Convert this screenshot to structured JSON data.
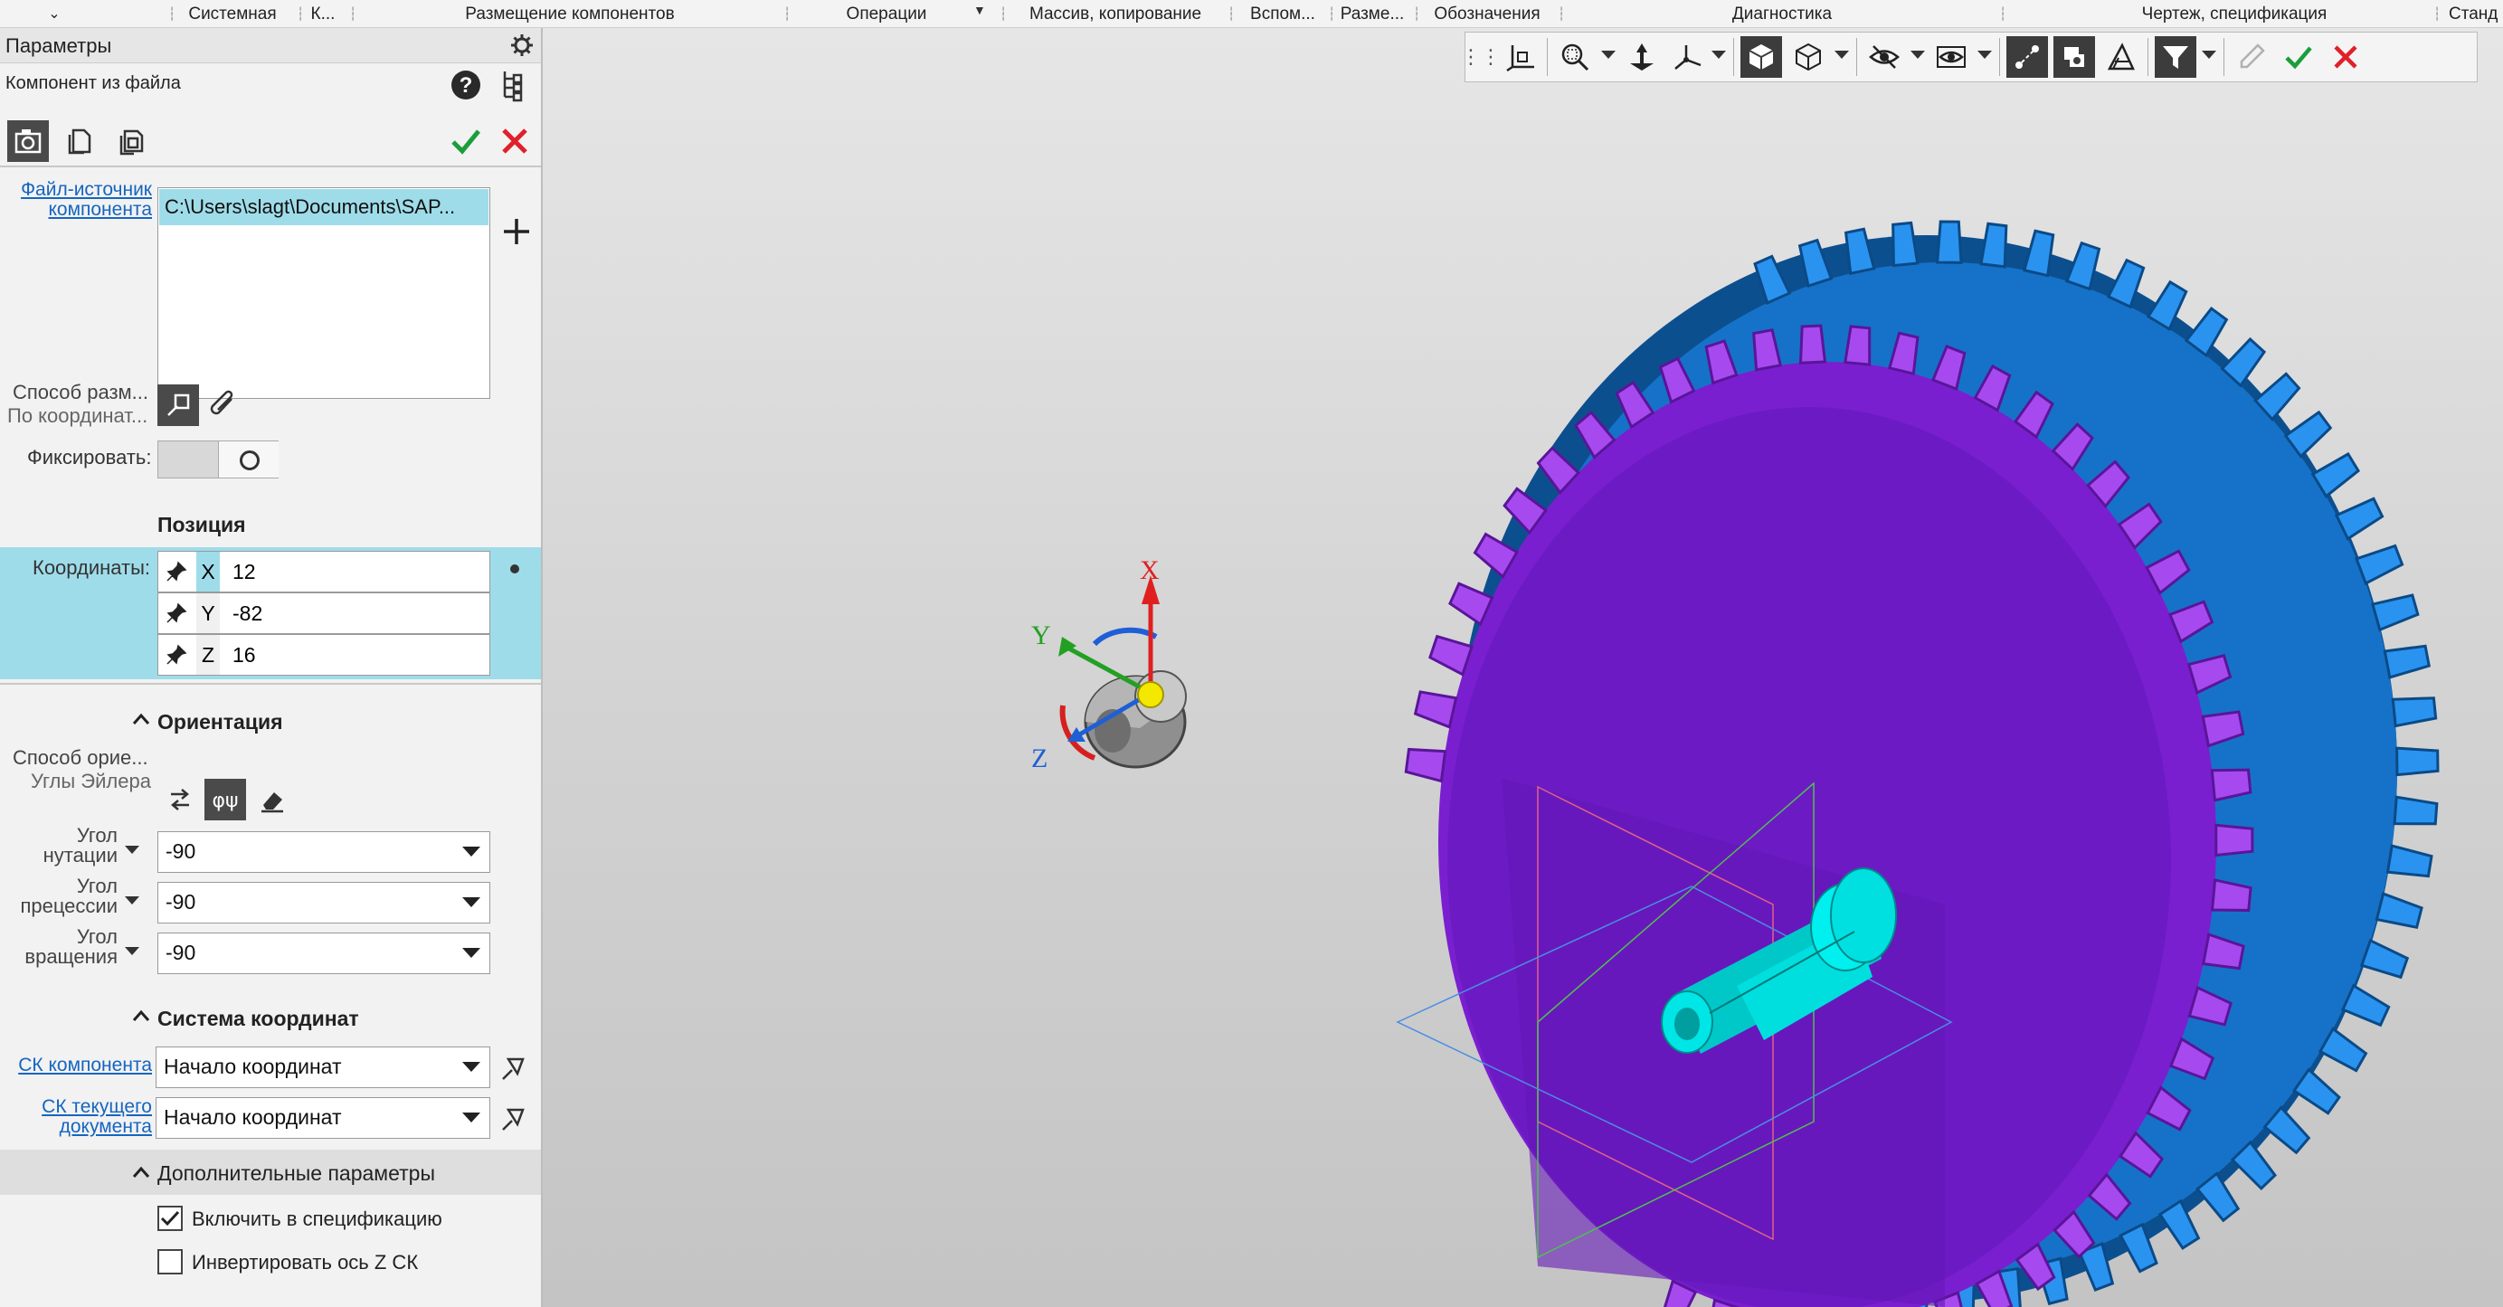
{
  "ribbon": {
    "tabs": [
      "Системная",
      "К...",
      "Размещение компонентов",
      "Операции",
      "Массив, копирование",
      "Вспом...",
      "Разме...",
      "Обозначения",
      "Диагностика",
      "Чертеж, спецификация",
      "Станд"
    ]
  },
  "panel": {
    "title": "Параметры",
    "command_title": "Компонент из файла",
    "source_file_label": "Файл-источник компонента",
    "source_file_value": "C:\\Users\\slagt\\Documents\\SAP...",
    "placement_method_label": "Способ разм...",
    "placement_method_value": "По координат...",
    "fix_label": "Фиксировать:",
    "position_title": "Позиция",
    "coords_label": "Координаты:",
    "coords": [
      {
        "axis": "X",
        "value": "12"
      },
      {
        "axis": "Y",
        "value": "-82"
      },
      {
        "axis": "Z",
        "value": "16"
      }
    ],
    "orientation_title": "Ориентация",
    "orient_method_label": "Способ орие...",
    "orient_method_value": "Углы Эйлера",
    "nutation_label": "Угол нутации",
    "nutation_value": "-90",
    "precession_label": "Угол прецессии",
    "precession_value": "-90",
    "rotation_label": "Угол вращения",
    "rotation_value": "-90",
    "cs_title": "Система координат",
    "cs_component_label": "СК компонента",
    "cs_component_value": "Начало координат",
    "cs_document_label": "СК текущего документа",
    "cs_document_value": "Начало координат",
    "extra_title": "Дополнительные параметры",
    "include_spec_label": "Включить в спецификацию",
    "include_spec_checked": true,
    "invert_z_label": "Инвертировать ось Z СК",
    "invert_z_checked": false
  },
  "viewport": {
    "triad_labels": {
      "x": "X",
      "y": "Y",
      "z": "Z"
    }
  },
  "colors": {
    "highlight": "#9fdce9",
    "gear_purple": "#8a2be2",
    "gear_blue": "#1e7fd6",
    "shaft": "#00e5e5",
    "accept": "#1a9e3a",
    "cancel": "#e0202a"
  }
}
